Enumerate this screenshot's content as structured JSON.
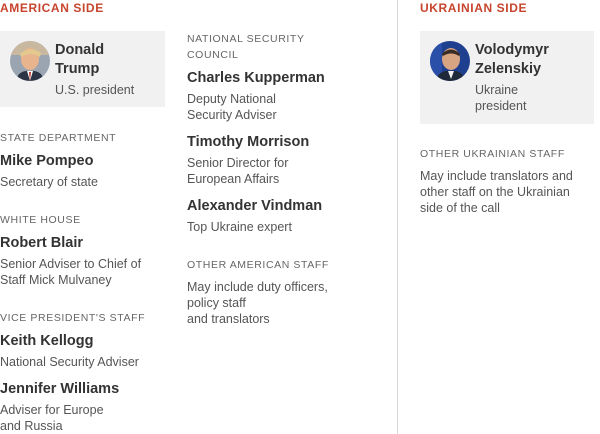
{
  "american": {
    "title": "AMERICAN SIDE",
    "leader": {
      "name_line1": "Donald",
      "name_line2": "Trump",
      "role": "U.S. president"
    },
    "state": {
      "label": "STATE DEPARTMENT",
      "name": "Mike Pompeo",
      "role": "Secretary of state"
    },
    "white_house": {
      "label": "WHITE HOUSE",
      "name": "Robert Blair",
      "role_line1": "Senior Adviser to Chief of",
      "role_line2": "Staff Mick Mulvaney"
    },
    "vp_staff": {
      "label": "VICE PRESIDENT'S STAFF",
      "people": [
        {
          "name": "Keith Kellogg",
          "role_line1": "National Security Adviser",
          "role_line2": ""
        },
        {
          "name": "Jennifer Williams",
          "role_line1": "Adviser for Europe",
          "role_line2": "and Russia"
        }
      ]
    },
    "nsc": {
      "label_line1": "NATIONAL SECURITY",
      "label_line2": "COUNCIL",
      "people": [
        {
          "name": "Charles Kupperman",
          "role_line1": "Deputy National",
          "role_line2": "Security Adviser"
        },
        {
          "name": "Timothy Morrison",
          "role_line1": "Senior Director for",
          "role_line2": "European Affairs"
        },
        {
          "name": "Alexander Vindman",
          "role_line1": "Top Ukraine expert",
          "role_line2": ""
        }
      ]
    },
    "other": {
      "label": "OTHER AMERICAN STAFF",
      "line1": "May include duty officers,",
      "line2": "policy staff",
      "line3": "and translators"
    }
  },
  "ukrainian": {
    "title": "UKRAINIAN SIDE",
    "leader": {
      "name_line1": "Volodymyr",
      "name_line2": "Zelenskiy",
      "role_line1": "Ukraine",
      "role_line2": "president"
    },
    "other": {
      "label": "OTHER UKRAINIAN STAFF",
      "line1": "May include translators and",
      "line2": "other staff on the Ukrainian",
      "line3": "side of the call"
    }
  },
  "colors": {
    "accent": "#c7442d",
    "card_bg": "#f1f1f1"
  }
}
